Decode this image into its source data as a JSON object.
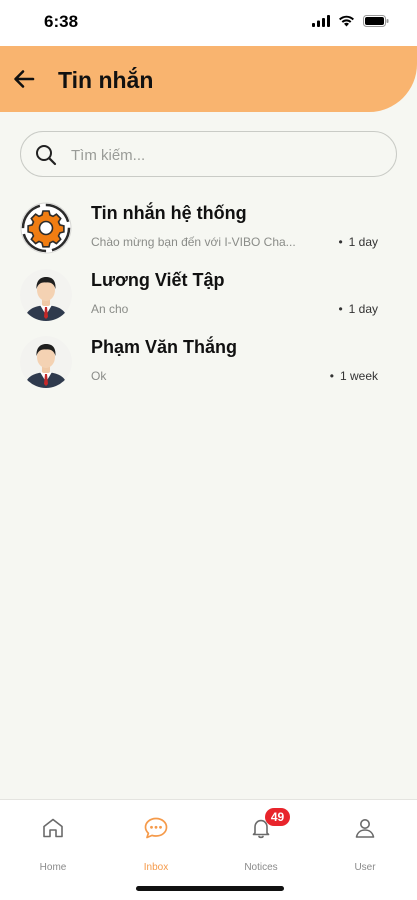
{
  "status_bar": {
    "time": "6:38"
  },
  "header": {
    "title": "Tin nhắn",
    "back_icon": "arrow-left-icon"
  },
  "search": {
    "placeholder": "Tìm kiếm...",
    "value": ""
  },
  "conversations": [
    {
      "name": "Tin nhắn hệ thống",
      "preview": "Chào mừng bạn đến với I-VIBO Cha...",
      "time": "1 day",
      "avatar": "gear-icon"
    },
    {
      "name": "Lương Viết Tập",
      "preview": "An cho",
      "time": "1 day",
      "avatar": "user-avatar"
    },
    {
      "name": "Phạm Văn Thắng",
      "preview": "Ok",
      "time": "1 week",
      "avatar": "user-avatar"
    }
  ],
  "tabbar": {
    "tabs": [
      {
        "label": "Home",
        "icon": "home-icon"
      },
      {
        "label": "Inbox",
        "icon": "chat-icon",
        "active": true
      },
      {
        "label": "Notices",
        "icon": "bell-icon",
        "badge": "49"
      },
      {
        "label": "User",
        "icon": "user-icon"
      }
    ]
  },
  "colors": {
    "accent": "#f9b46f",
    "active_tab": "#f59a4a",
    "badge": "#e8242b"
  }
}
